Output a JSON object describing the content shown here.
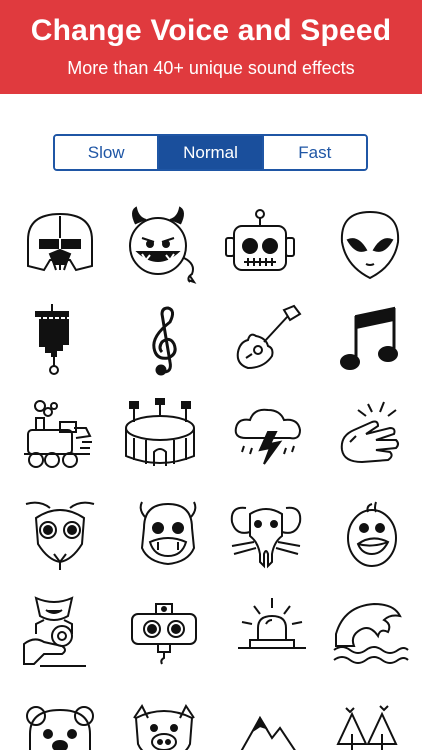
{
  "header": {
    "title": "Change Voice and Speed",
    "subtitle": "More than 40+ unique sound effects",
    "background": "#e03a3e"
  },
  "speed_control": {
    "options": [
      "Slow",
      "Normal",
      "Fast"
    ],
    "selected": "Normal",
    "accent": "#1a4f9c"
  },
  "effects": [
    {
      "icon": "darth-vader-icon"
    },
    {
      "icon": "devil-icon"
    },
    {
      "icon": "robot-icon"
    },
    {
      "icon": "alien-icon"
    },
    {
      "icon": "wind-chime-icon"
    },
    {
      "icon": "treble-clef-icon"
    },
    {
      "icon": "guitar-icon"
    },
    {
      "icon": "music-note-icon"
    },
    {
      "icon": "train-icon"
    },
    {
      "icon": "stadium-icon"
    },
    {
      "icon": "thunderstorm-icon"
    },
    {
      "icon": "clapping-hands-icon"
    },
    {
      "icon": "ant-icon"
    },
    {
      "icon": "chipmunk-icon"
    },
    {
      "icon": "elephant-icon"
    },
    {
      "icon": "duck-icon"
    },
    {
      "icon": "hand-with-flower-icon"
    },
    {
      "icon": "speaker-robot-icon"
    },
    {
      "icon": "alarm-siren-icon"
    },
    {
      "icon": "ocean-wave-icon"
    },
    {
      "icon": "bear-icon"
    },
    {
      "icon": "pig-icon"
    },
    {
      "icon": "mountain-icon"
    },
    {
      "icon": "forest-icon"
    }
  ]
}
